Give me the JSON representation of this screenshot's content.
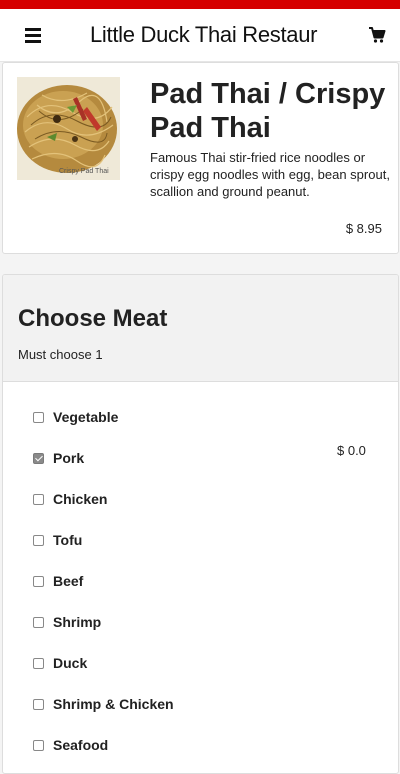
{
  "header": {
    "restaurant_name": "Little Duck Thai Restaur"
  },
  "item": {
    "title": "Pad Thai / Crispy Pad Thai",
    "image_caption": "Crispy Pad Thai",
    "description": "Famous Thai stir-fried rice noodles or crispy egg noodles with egg, bean sprout, scallion and ground peanut.",
    "price": "$ 8.95"
  },
  "options": {
    "title": "Choose Meat",
    "subtitle": "Must choose 1",
    "price_label": "$ 0.0",
    "items": [
      {
        "label": "Vegetable",
        "checked": false
      },
      {
        "label": "Pork",
        "checked": true
      },
      {
        "label": "Chicken",
        "checked": false
      },
      {
        "label": "Tofu",
        "checked": false
      },
      {
        "label": "Beef",
        "checked": false
      },
      {
        "label": "Shrimp",
        "checked": false
      },
      {
        "label": "Duck",
        "checked": false
      },
      {
        "label": "Shrimp & Chicken",
        "checked": false
      },
      {
        "label": "Seafood",
        "checked": false
      }
    ]
  },
  "colors": {
    "accent": "#d50000"
  }
}
